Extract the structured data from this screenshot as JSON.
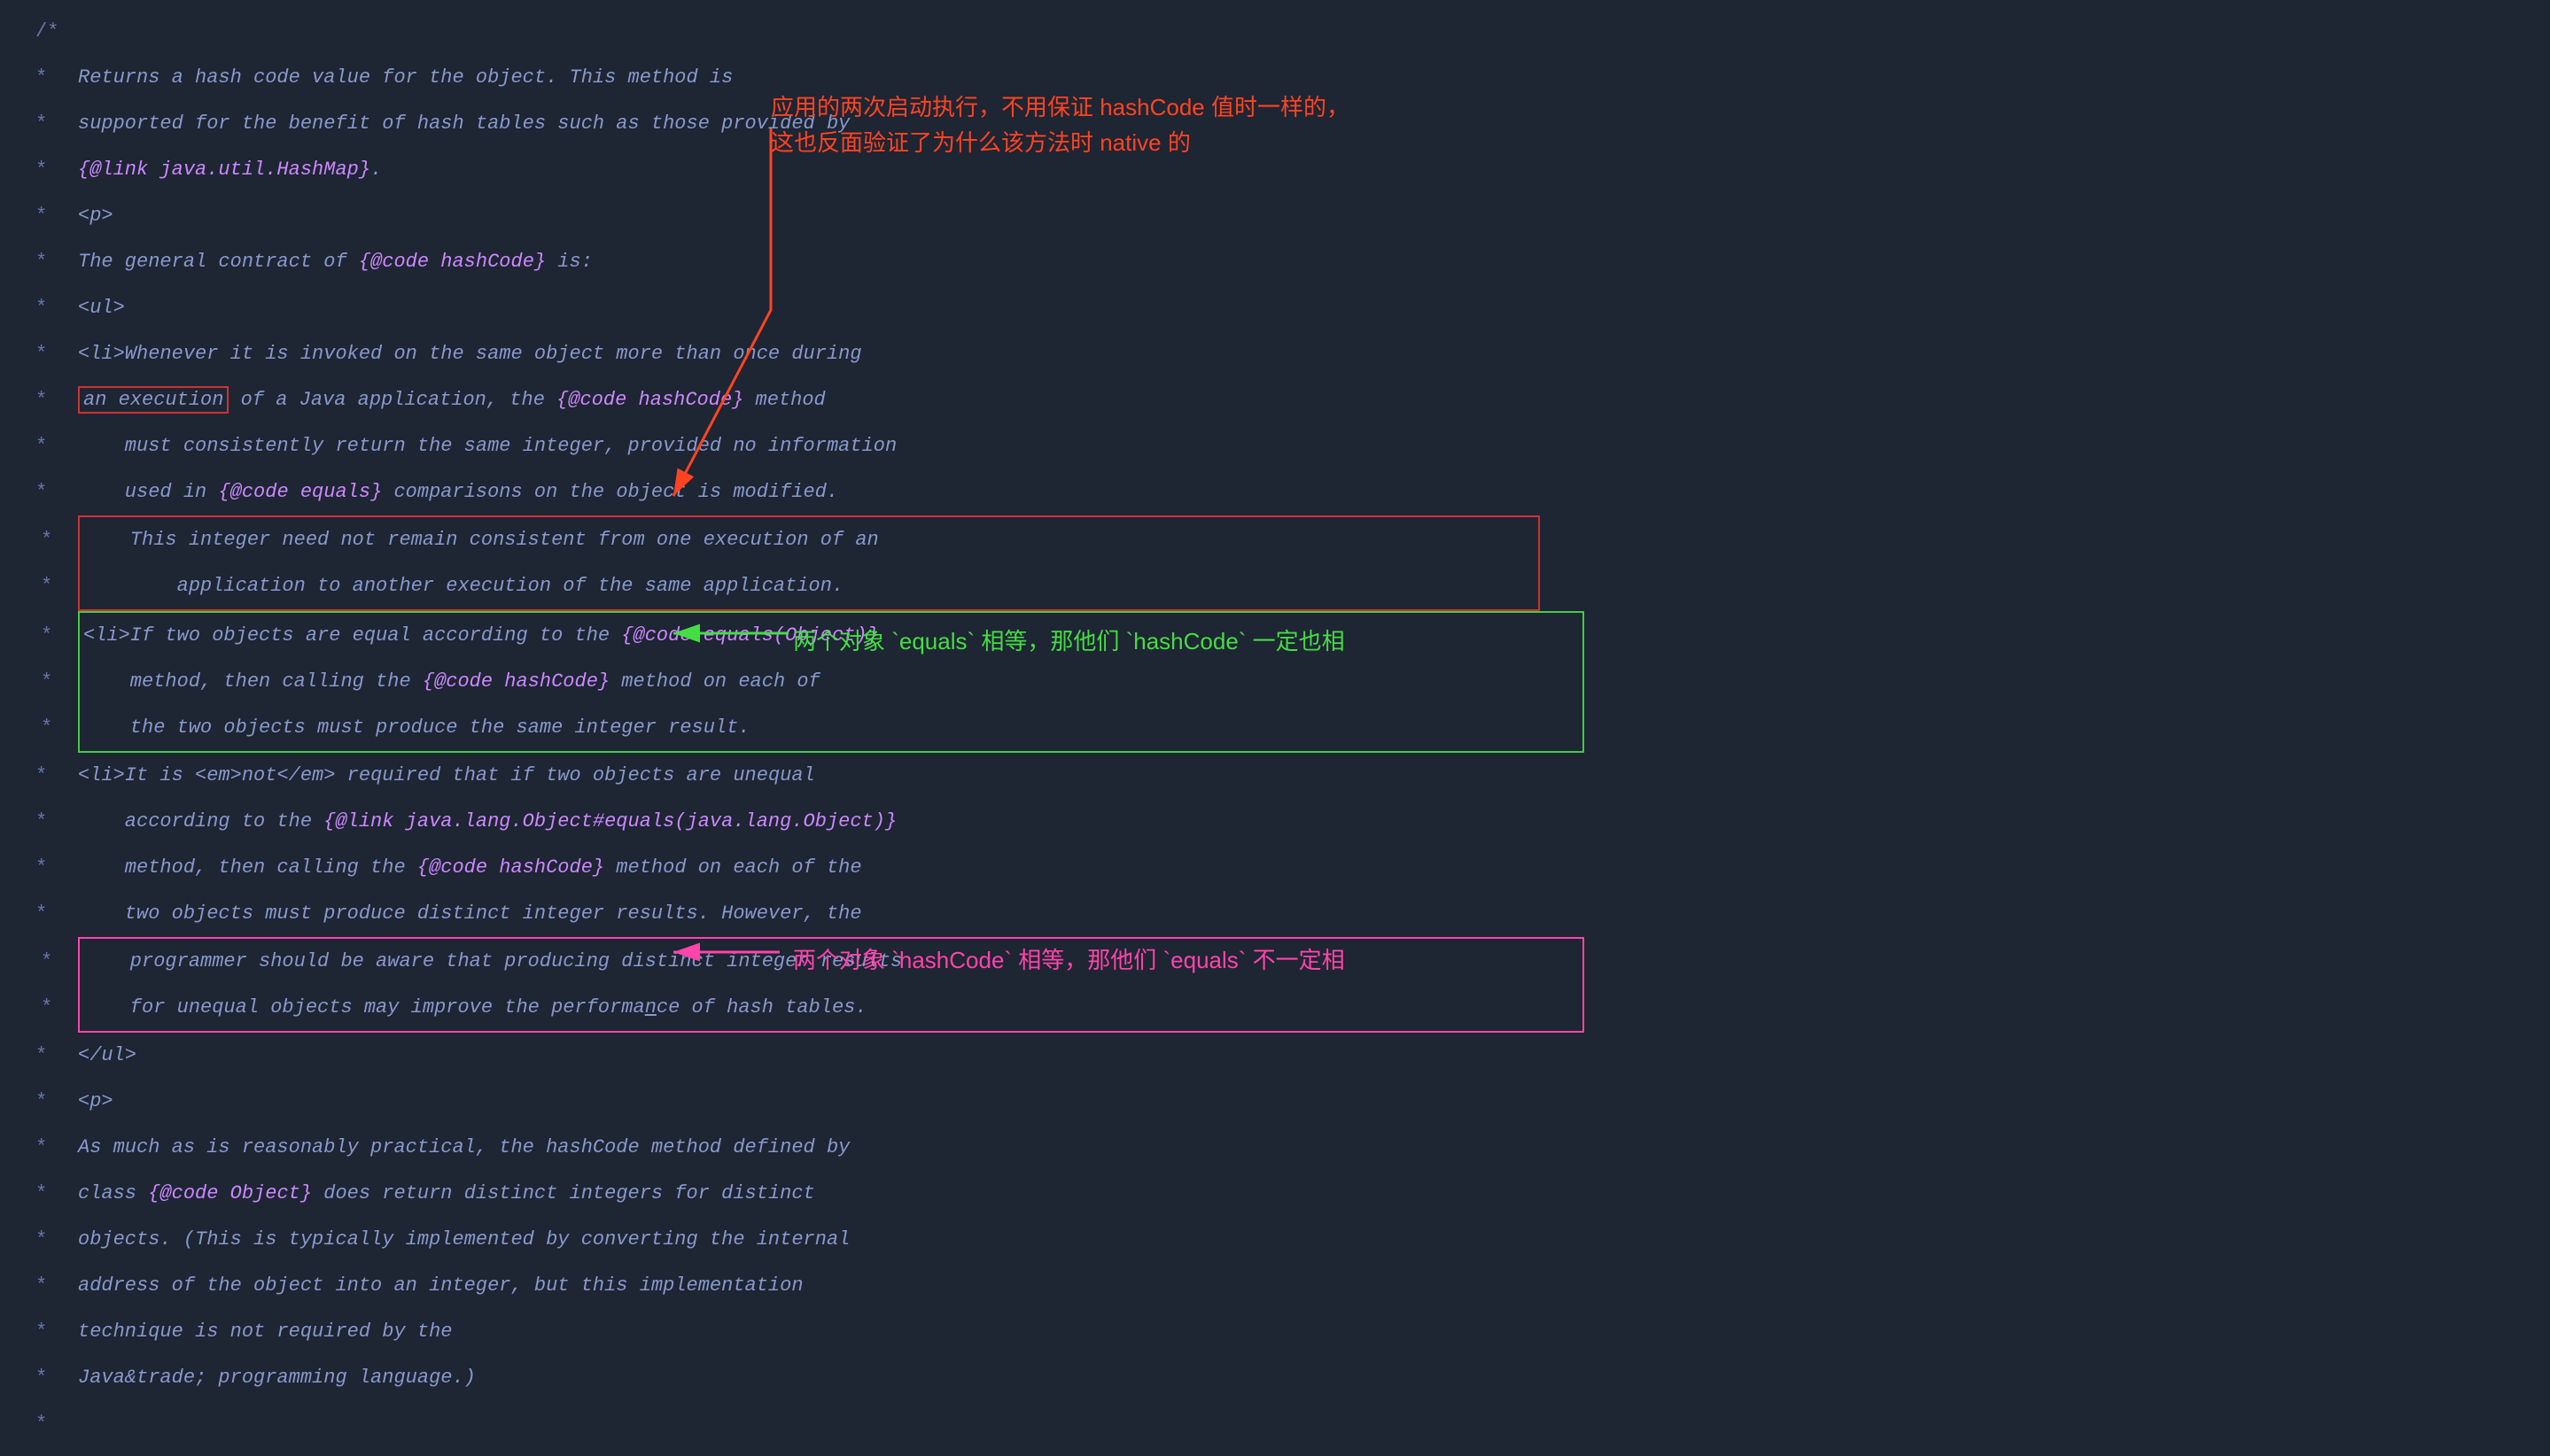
{
  "bg_color": "#1e2533",
  "code_color": "#8899cc",
  "lines": [
    {
      "star": "/*",
      "text": "",
      "type": "comment_start"
    },
    {
      "star": "*",
      "text": "Returns a hash code value for the object. This method is",
      "type": "plain"
    },
    {
      "star": "*",
      "text": "supported for the benefit of hash tables such as those provided by",
      "type": "plain"
    },
    {
      "star": "*",
      "text": "",
      "parts": [
        {
          "text": "{@link java.util.HashMap}",
          "style": "link"
        },
        {
          "text": ".",
          "style": "plain"
        }
      ],
      "type": "mixed"
    },
    {
      "star": "*",
      "text": "<p>",
      "type": "plain"
    },
    {
      "star": "*",
      "text": "",
      "parts": [
        {
          "text": "The general contract of ",
          "style": "plain"
        },
        {
          "text": "{@code hashCode}",
          "style": "code"
        },
        {
          "text": " is:",
          "style": "plain"
        }
      ],
      "type": "mixed"
    },
    {
      "star": "*",
      "text": "<ul>",
      "type": "plain"
    },
    {
      "star": "*",
      "text": "<li>Whenever it is invoked on the same object more than once during",
      "type": "plain"
    },
    {
      "star": "*",
      "text": "",
      "parts": [
        {
          "text": "an execution",
          "style": "highlight_red"
        },
        {
          "text": " of a Java application, the ",
          "style": "plain"
        },
        {
          "text": "{@code hashCode}",
          "style": "code"
        },
        {
          "text": " method",
          "style": "plain"
        }
      ],
      "type": "mixed"
    },
    {
      "star": "*",
      "text": "    must consistently return the same integer, provided no information",
      "type": "plain"
    },
    {
      "star": "*",
      "text": "",
      "parts": [
        {
          "text": "    used in ",
          "style": "plain"
        },
        {
          "text": "{@code equals}",
          "style": "code"
        },
        {
          "text": " comparisons on the object is modified.",
          "style": "plain"
        }
      ],
      "type": "mixed"
    },
    {
      "star": "*",
      "text": "",
      "parts": [
        {
          "text": "This integer need not remain consistent from one execution of an",
          "style": "highlight_red_block"
        }
      ],
      "type": "red_block_start"
    },
    {
      "star": "*",
      "text": "",
      "parts": [
        {
          "text": "    application to another execution of the same application.",
          "style": "highlight_red_block"
        }
      ],
      "type": "red_block_end"
    },
    {
      "star": "*",
      "text": "",
      "parts": [
        {
          "text": "<li>If two objects are equal according to the ",
          "style": "highlight_green_block"
        },
        {
          "text": "{@code equals(Object)}",
          "style": "code_green"
        }
      ],
      "type": "green_block_start"
    },
    {
      "star": "*",
      "text": "",
      "parts": [
        {
          "text": "    method, then calling the ",
          "style": "highlight_green_block"
        },
        {
          "text": "{@code hashCode}",
          "style": "code_green"
        },
        {
          "text": " method on each of",
          "style": "highlight_green_block"
        }
      ],
      "type": "green_block_mid"
    },
    {
      "star": "*",
      "text": "",
      "parts": [
        {
          "text": "    the two objects must produce the same integer result.",
          "style": "highlight_green_block"
        }
      ],
      "type": "green_block_end"
    },
    {
      "star": "*",
      "text": "<li>It is <em>not</em> required that if two objects are unequal",
      "type": "plain_em"
    },
    {
      "star": "*",
      "text": "",
      "parts": [
        {
          "text": "    according to the ",
          "style": "plain"
        },
        {
          "text": "{@link java.lang.Object#equals(java.lang.Object)}",
          "style": "link"
        }
      ],
      "type": "mixed"
    },
    {
      "star": "*",
      "text": "",
      "parts": [
        {
          "text": "    method, then calling the ",
          "style": "plain"
        },
        {
          "text": "{@code hashCode}",
          "style": "code"
        },
        {
          "text": " method on each of the",
          "style": "plain"
        }
      ],
      "type": "mixed"
    },
    {
      "star": "*",
      "text": "    two objects must produce distinct integer results.  However, the",
      "type": "plain"
    },
    {
      "star": "*",
      "text": "",
      "parts": [
        {
          "text": "    programmer should be aware that producing distinct integer results",
          "style": "highlight_pink_block"
        }
      ],
      "type": "pink_block_start"
    },
    {
      "star": "*",
      "text": "",
      "parts": [
        {
          "text": "    for unequal objects may improve the performance of hash tables.",
          "style": "highlight_pink_block"
        }
      ],
      "type": "pink_block_end"
    },
    {
      "star": "*",
      "text": "</ul>",
      "type": "plain"
    },
    {
      "star": "*",
      "text": "<p>",
      "type": "plain"
    },
    {
      "star": "*",
      "text": "As much as is reasonably practical, the hashCode method defined by",
      "type": "plain"
    },
    {
      "star": "*",
      "text": "",
      "parts": [
        {
          "text": "class ",
          "style": "plain"
        },
        {
          "text": "{@code Object}",
          "style": "code"
        },
        {
          "text": " does return distinct integers for distinct",
          "style": "plain"
        }
      ],
      "type": "mixed"
    },
    {
      "star": "*",
      "text": "objects. (This is typically implemented by converting the internal",
      "type": "plain"
    },
    {
      "star": "*",
      "text": "address of the object into an integer, but this implementation",
      "type": "plain"
    },
    {
      "star": "*",
      "text": "technique is not required by the",
      "type": "plain"
    },
    {
      "star": "*",
      "text": "Java&trade; programming language.)",
      "type": "plain"
    },
    {
      "star": "*",
      "text": "",
      "type": "plain"
    }
  ],
  "annotations": {
    "red": {
      "text_line1": "应用的两次启动执行，不用保证 hashCode 值时一样的，",
      "text_line2": "这也反面验证了为什么该方法时 native 的",
      "color": "#ff4422"
    },
    "green": {
      "text": "两个对象 `equals` 相等，那他们 `hashCode` 一定也相",
      "color": "#44dd44"
    },
    "pink": {
      "text": "两个对象 `hashCode` 相等，那他们 `equals` 不一定相",
      "color": "#ff44aa"
    }
  }
}
